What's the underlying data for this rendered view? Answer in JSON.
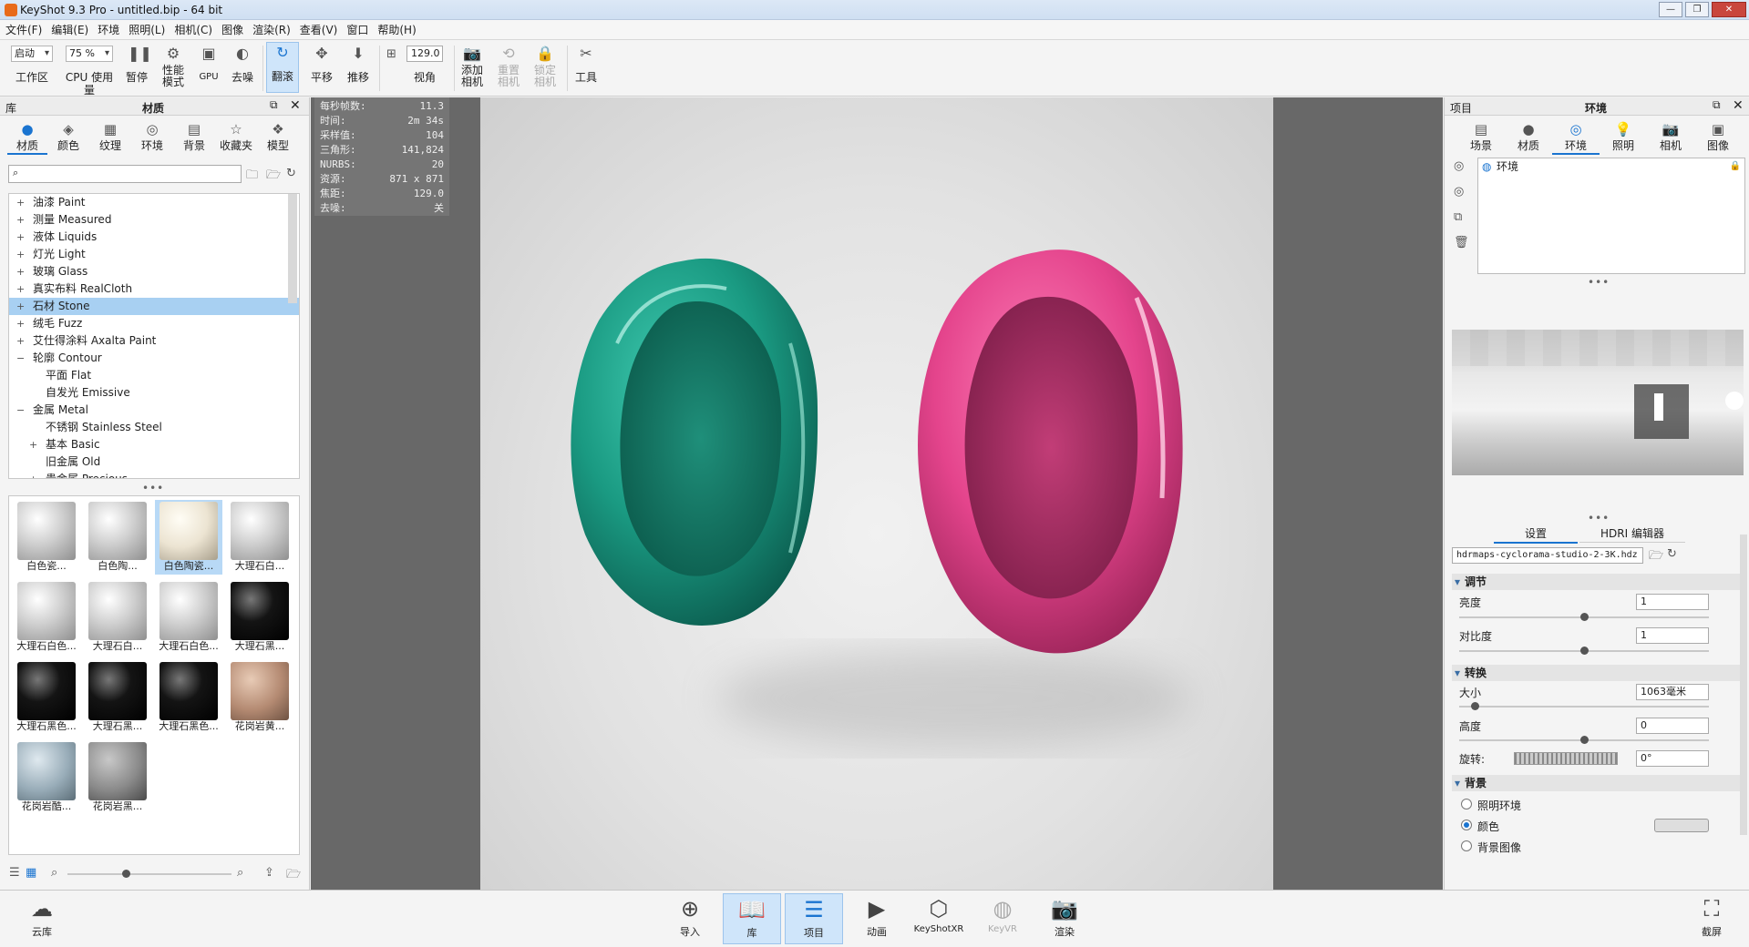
{
  "window": {
    "title": "KeyShot 9.3 Pro  - untitled.bip  - 64 bit"
  },
  "menu": [
    "文件(F)",
    "编辑(E)",
    "环境",
    "照明(L)",
    "相机(C)",
    "图像",
    "渲染(R)",
    "查看(V)",
    "窗口",
    "帮助(H)"
  ],
  "toolbar": {
    "workspace_value": "启动",
    "workspace_label": "工作区",
    "cpu_value": "75 %",
    "cpu_label": "CPU 使用量",
    "pause_label": "暂停",
    "perf_label": "性能\n模式",
    "gpu_label": "GPU",
    "denoise_label": "去噪",
    "tumble_label": "翻滚",
    "pan_label": "平移",
    "dolly_label": "推移",
    "fov_value": "129.0",
    "fov_label": "视角",
    "add_cam_label": "添加\n相机",
    "reset_cam_label": "重置\n相机",
    "lock_cam_label": "锁定\n相机",
    "tools_label": "工具"
  },
  "library": {
    "panel_title": "库",
    "panel_subtitle": "材质",
    "tabs": [
      "材质",
      "颜色",
      "纹理",
      "环境",
      "背景",
      "收藏夹",
      "模型"
    ],
    "tree": [
      {
        "label": "油漆 Paint",
        "indent": 0,
        "sign": "+"
      },
      {
        "label": "测量 Measured",
        "indent": 0,
        "sign": "+"
      },
      {
        "label": "液体 Liquids",
        "indent": 0,
        "sign": "+"
      },
      {
        "label": "灯光 Light",
        "indent": 0,
        "sign": "+"
      },
      {
        "label": "玻璃 Glass",
        "indent": 0,
        "sign": "+"
      },
      {
        "label": "真实布料 RealCloth",
        "indent": 0,
        "sign": "+"
      },
      {
        "label": "石材 Stone",
        "indent": 0,
        "sign": "+"
      },
      {
        "label": "绒毛 Fuzz",
        "indent": 0,
        "sign": "+"
      },
      {
        "label": "艾仕得涂料 Axalta Paint",
        "indent": 0,
        "sign": "+"
      },
      {
        "label": "轮廓 Contour",
        "indent": 0,
        "sign": "−"
      },
      {
        "label": "平面 Flat",
        "indent": 1,
        "sign": ""
      },
      {
        "label": "自发光 Emissive",
        "indent": 1,
        "sign": ""
      },
      {
        "label": "金属 Metal",
        "indent": 0,
        "sign": "−"
      },
      {
        "label": "不锈钢 Stainless Steel",
        "indent": 1,
        "sign": ""
      },
      {
        "label": "基本 Basic",
        "indent": 1,
        "sign": "+"
      },
      {
        "label": "旧金属 Old",
        "indent": 1,
        "sign": ""
      },
      {
        "label": "贵金属 Precious",
        "indent": 1,
        "sign": "+"
      }
    ],
    "selected_tree_item": "石材 Stone",
    "thumbnails": [
      {
        "label": "白色瓷...",
        "style": "white-marble"
      },
      {
        "label": "白色陶...",
        "style": "white-marble"
      },
      {
        "label": "白色陶瓷...",
        "style": "cream"
      },
      {
        "label": "大理石白...",
        "style": "white-marble"
      },
      {
        "label": "大理石白色...",
        "style": "white-marble"
      },
      {
        "label": "大理石白...",
        "style": "white-marble"
      },
      {
        "label": "大理石白色...",
        "style": "white-marble"
      },
      {
        "label": "大理石黑...",
        "style": "black"
      },
      {
        "label": "大理石黑色...",
        "style": "black"
      },
      {
        "label": "大理石黑...",
        "style": "black"
      },
      {
        "label": "大理石黑色...",
        "style": "black"
      },
      {
        "label": "花岗岩黄...",
        "style": "tan"
      },
      {
        "label": "花岗岩酷...",
        "style": "bluegray"
      },
      {
        "label": "花岗岩黑...",
        "style": "gray"
      }
    ],
    "selected_thumbnail_index": 2
  },
  "viewport": {
    "hud": [
      {
        "k": "每秒帧数:",
        "v": "11.3"
      },
      {
        "k": "时间:",
        "v": "2m 34s"
      },
      {
        "k": "采样值:",
        "v": "104"
      },
      {
        "k": "三角形:",
        "v": "141,824"
      },
      {
        "k": "NURBS:",
        "v": "20"
      },
      {
        "k": "资源:",
        "v": "871 x 871"
      },
      {
        "k": "焦距:",
        "v": "129.0"
      },
      {
        "k": "去噪:",
        "v": "关"
      }
    ],
    "colors": {
      "teal": "#1f9e86",
      "pink": "#e0468a"
    }
  },
  "project": {
    "panel_title": "项目",
    "panel_subtitle": "环境",
    "tabs": [
      "场景",
      "材质",
      "环境",
      "照明",
      "相机",
      "图像"
    ],
    "env_list": [
      "环境"
    ],
    "subtabs": [
      "设置",
      "HDRI 编辑器"
    ],
    "hdri_file": "hdrmaps-cyclorama-studio-2-3K.hdz",
    "adjust_title": "调节",
    "brightness_label": "亮度",
    "brightness_value": "1",
    "brightness_level": 0.5,
    "contrast_label": "对比度",
    "contrast_value": "1",
    "contrast_level": 0.5,
    "transform_title": "转换",
    "size_label": "大小",
    "size_value": "1063毫米",
    "size_level": 0.05,
    "height_label": "高度",
    "height_value": "0",
    "height_level": 0.5,
    "rotation_label": "旋转:",
    "rotation_value": "0°",
    "background_title": "背景",
    "bg_options": [
      "照明环境",
      "颜色",
      "背景图像"
    ],
    "bg_selected": "颜色"
  },
  "bottom": {
    "cloud_label": "云库",
    "buttons": [
      "导入",
      "库",
      "项目",
      "动画",
      "KeyShotXR",
      "KeyVR",
      "渲染"
    ],
    "active": [
      "库",
      "项目"
    ],
    "screenshot_label": "截屏"
  }
}
